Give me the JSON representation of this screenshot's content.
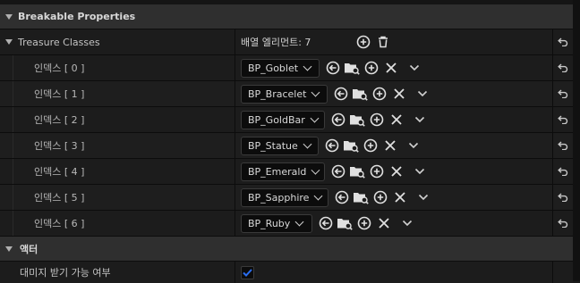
{
  "sections": {
    "breakable": "Breakable Properties",
    "actor": "액터"
  },
  "treasure": {
    "label": "Treasure Classes",
    "count_text": "배열 엘리먼트: 7",
    "elements": [
      {
        "index": "인덱스 [ 0 ]",
        "value": "BP_Goblet"
      },
      {
        "index": "인덱스 [ 1 ]",
        "value": "BP_Bracelet"
      },
      {
        "index": "인덱스 [ 2 ]",
        "value": "BP_GoldBar"
      },
      {
        "index": "인덱스 [ 3 ]",
        "value": "BP_Statue"
      },
      {
        "index": "인덱스 [ 4 ]",
        "value": "BP_Emerald"
      },
      {
        "index": "인덱스 [ 5 ]",
        "value": "BP_Sapphire"
      },
      {
        "index": "인덱스 [ 6 ]",
        "value": "BP_Ruby"
      }
    ]
  },
  "actor": {
    "can_be_damaged_label": "대미지 받기 가능 여부",
    "can_be_damaged": true
  },
  "colors": {
    "accent": "#2a6df0",
    "icon": "#e0e0e0"
  },
  "icons": {
    "reset": "reset-arrow-icon",
    "add": "plus-circle-icon",
    "delete": "trash-icon",
    "use": "arrow-left-circle-icon",
    "browse": "folder-search-icon",
    "clear": "x-icon",
    "more": "chevron-down-icon"
  }
}
